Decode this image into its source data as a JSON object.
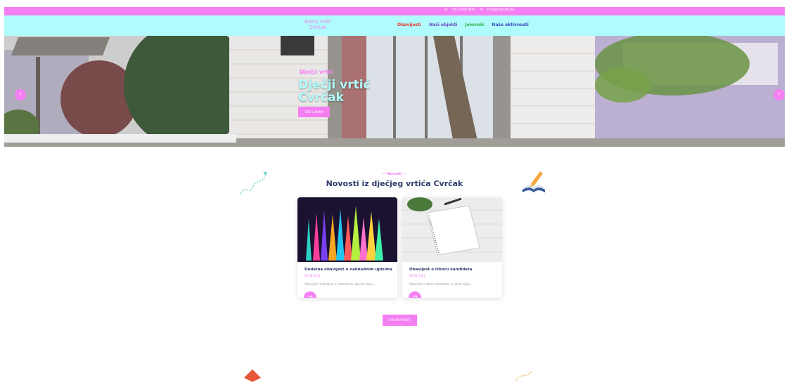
{
  "topbar": {
    "phone": "051 000 000",
    "email": "info@cvrcak.ba"
  },
  "logo": {
    "line1": "Dječji vrtić",
    "line2": "Cvrčak"
  },
  "menu": [
    "Obavijesti",
    "Naši objekti",
    "Jelovnik",
    "Naše aktivnosti"
  ],
  "hero": {
    "subtitle": "Dječji vrtić",
    "title_line1": "Dječji vrtić",
    "title_line2": "Cvrčak",
    "button": "VIŠE O NAMA",
    "prev": "‹",
    "next": "›"
  },
  "news": {
    "kicker": "Novosti",
    "title": "Novosti iz dječjeg vrtića Cvrčak",
    "cards": [
      {
        "title": "Dodatna obavijest o naknadnim upisima",
        "date": "06.08.2021",
        "excerpt": "Obavijest roditeljima o naknadnim upisima djece...",
        "arrow": "→"
      },
      {
        "title": "Obavijest o izboru kandidata",
        "date": "06.08.2021",
        "excerpt": "Obavijest o izboru kandidata na javni oglas...",
        "arrow": "→"
      }
    ],
    "all_button": "SVE OBAVIJESTI"
  },
  "colors": {
    "pink": "#f57ef2",
    "cyan": "#b0fbfb",
    "navy": "#2f3b6b"
  }
}
